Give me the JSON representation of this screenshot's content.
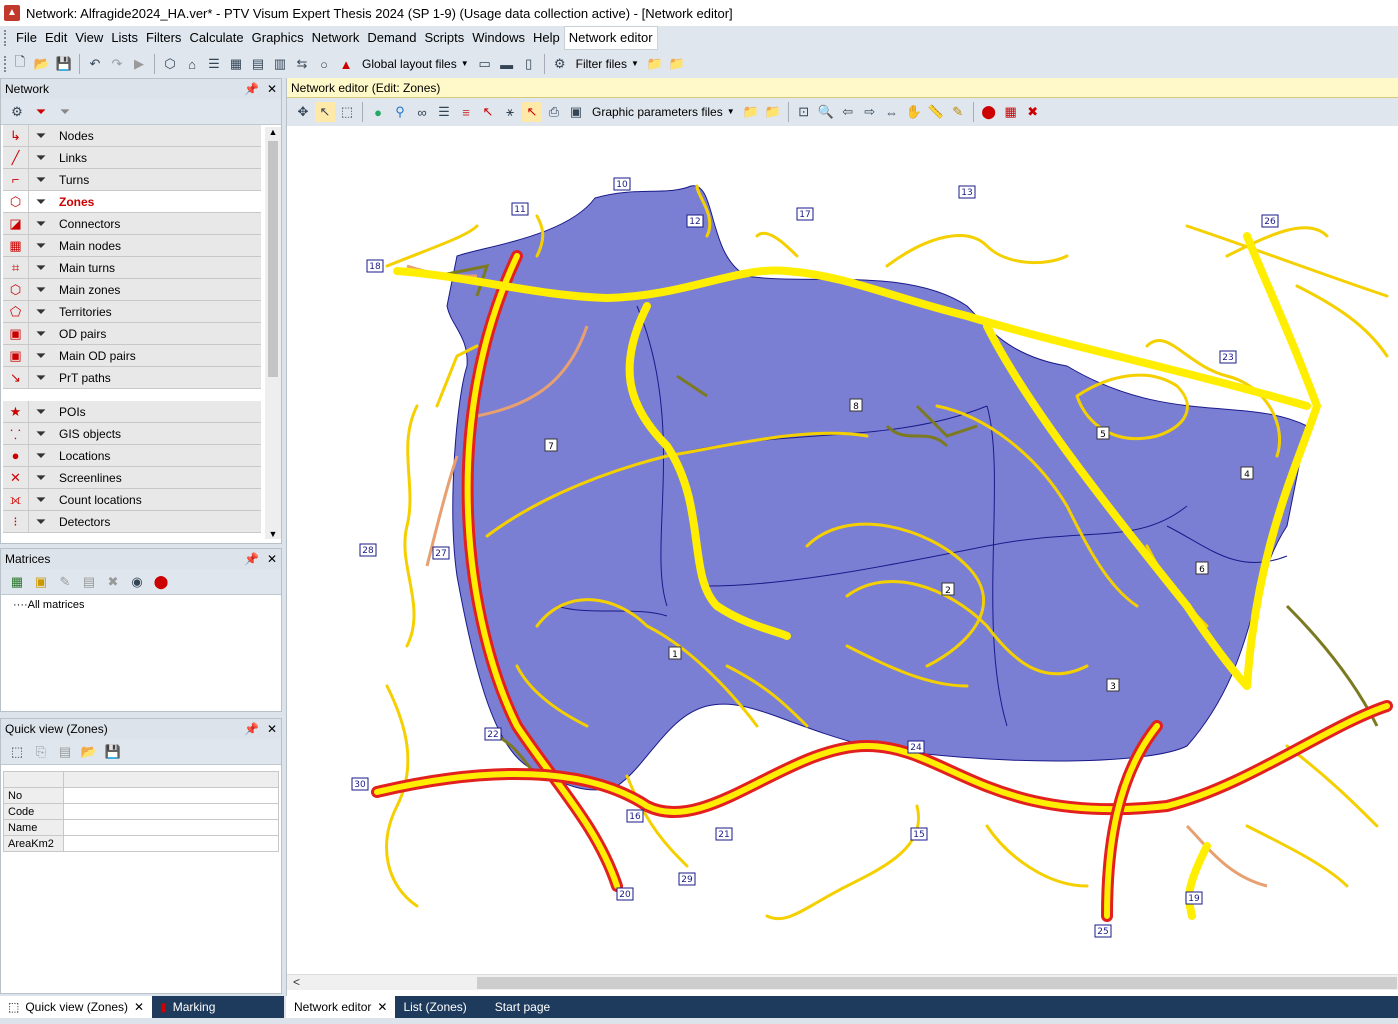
{
  "window": {
    "title": "Network: Alfragide2024_HA.ver* - PTV Visum Expert Thesis 2024 (SP 1-9) (Usage data collection active) - [Network editor]"
  },
  "menu": [
    "File",
    "Edit",
    "View",
    "Lists",
    "Filters",
    "Calculate",
    "Graphics",
    "Network",
    "Demand",
    "Scripts",
    "Windows",
    "Help",
    "Network editor"
  ],
  "toolbar": {
    "layout_label": "Global layout files",
    "filter_label": "Filter files"
  },
  "network_panel": {
    "title": "Network",
    "items": [
      {
        "label": "Nodes",
        "icon": "node-icon"
      },
      {
        "label": "Links",
        "icon": "link-icon"
      },
      {
        "label": "Turns",
        "icon": "turn-icon"
      },
      {
        "label": "Zones",
        "icon": "zone-icon",
        "selected": true
      },
      {
        "label": "Connectors",
        "icon": "connector-icon"
      },
      {
        "label": "Main nodes",
        "icon": "main-node-icon"
      },
      {
        "label": "Main turns",
        "icon": "main-turn-icon"
      },
      {
        "label": "Main zones",
        "icon": "main-zone-icon"
      },
      {
        "label": "Territories",
        "icon": "territory-icon"
      },
      {
        "label": "OD pairs",
        "icon": "od-pair-icon"
      },
      {
        "label": "Main OD pairs",
        "icon": "main-od-pair-icon"
      },
      {
        "label": "PrT paths",
        "icon": "prt-path-icon"
      },
      {
        "label": "POIs",
        "icon": "poi-icon"
      },
      {
        "label": "GIS objects",
        "icon": "gis-icon"
      },
      {
        "label": "Locations",
        "icon": "location-icon"
      },
      {
        "label": "Screenlines",
        "icon": "screenline-icon"
      },
      {
        "label": "Count locations",
        "icon": "count-location-icon"
      },
      {
        "label": "Detectors",
        "icon": "detector-icon"
      }
    ]
  },
  "matrices_panel": {
    "title": "Matrices",
    "tree_root": "All matrices"
  },
  "quickview_panel": {
    "title": "Quick view (Zones)",
    "rows": [
      "No",
      "Code",
      "Name",
      "AreaKm2"
    ]
  },
  "bottom_tabs_left": [
    "Quick view (Zones)",
    "Marking"
  ],
  "bottom_tabs_right": [
    "Network editor",
    "List (Zones)",
    "Start page"
  ],
  "editor": {
    "header": "Network editor (Edit: Zones)",
    "graphic_params_label": "Graphic parameters files"
  },
  "zones": [
    "1",
    "2",
    "3",
    "4",
    "5",
    "6",
    "7",
    "8"
  ],
  "connector_labels": [
    "10",
    "11",
    "12",
    "13",
    "15",
    "16",
    "17",
    "18",
    "19",
    "20",
    "21",
    "22",
    "23",
    "24",
    "25",
    "26",
    "27",
    "28",
    "29",
    "30"
  ],
  "colors": {
    "zone_fill": "#7b7fd3",
    "zone_edge": "#1a1a8a",
    "road": "#f5d000",
    "highway_casing": "#e32020",
    "highway_core": "#ffee00",
    "ramp": "#e8a070",
    "minor": "#7b7a20"
  }
}
